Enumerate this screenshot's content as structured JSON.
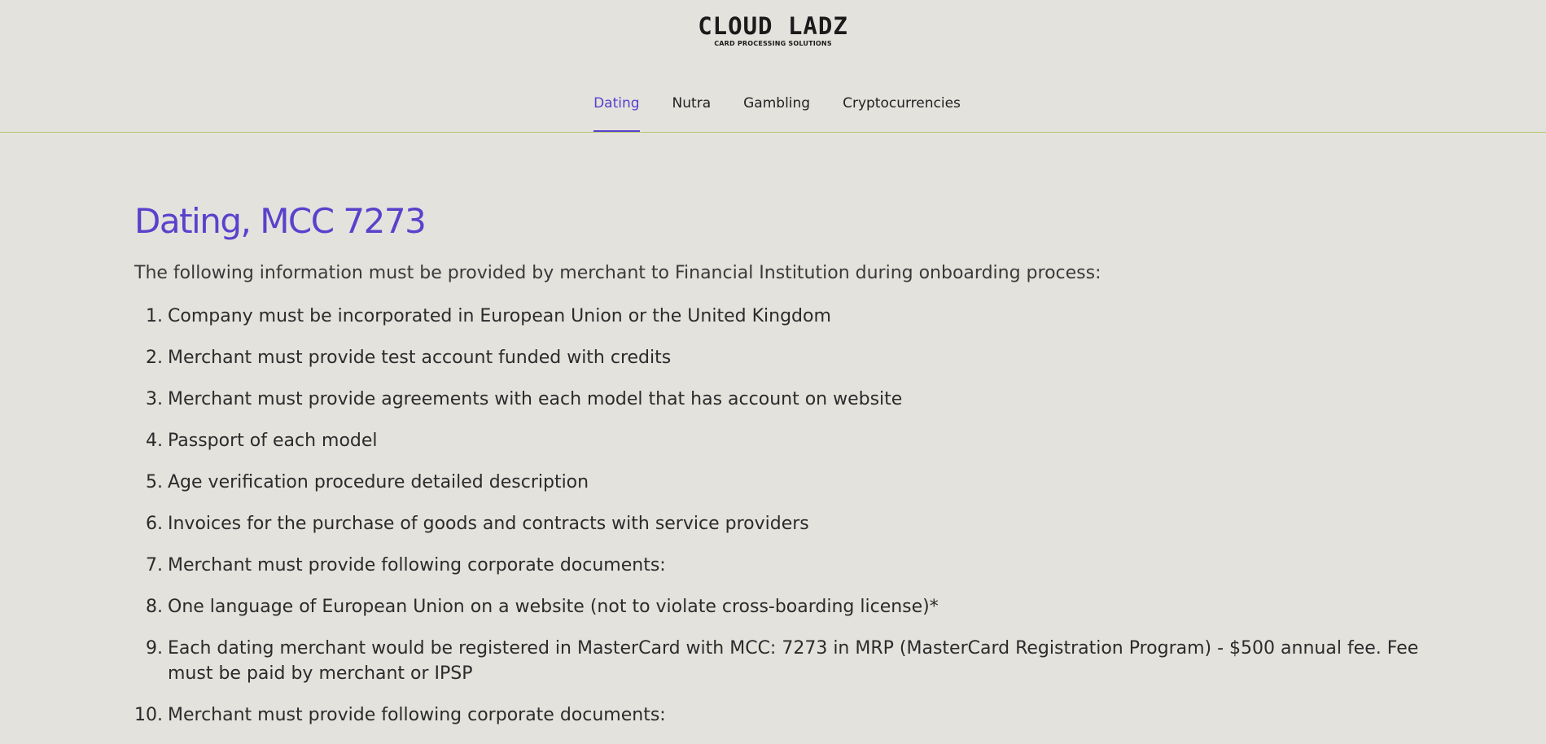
{
  "logo": {
    "title": "CLOUD LADZ",
    "subtitle": "CARD PROCESSING SOLUTIONS"
  },
  "nav": {
    "tabs": [
      {
        "label": "Dating",
        "active": true
      },
      {
        "label": "Nutra",
        "active": false
      },
      {
        "label": "Gambling",
        "active": false
      },
      {
        "label": "Cryptocurrencies",
        "active": false
      }
    ]
  },
  "main": {
    "title": "Dating, MCC 7273",
    "intro": "The following information must be provided by merchant to Financial Institution during onboarding process:",
    "requirements": [
      {
        "num": "1.",
        "text": "Company must be incorporated in European Union or the United Kingdom"
      },
      {
        "num": "2.",
        "text": "Merchant must provide test account funded with credits"
      },
      {
        "num": "3.",
        "text": "Merchant must provide agreements with each model that has account on website"
      },
      {
        "num": "4.",
        "text": "Passport of each model"
      },
      {
        "num": "5.",
        "text": "Age verification procedure detailed description"
      },
      {
        "num": "6.",
        "text": "Invoices for the purchase of goods and contracts with service providers"
      },
      {
        "num": "7.",
        "text": "Merchant must provide following corporate documents:"
      },
      {
        "num": "8.",
        "text": "One language of European Union on a website (not to violate cross-boarding license)*"
      },
      {
        "num": "9.",
        "text": "Each dating merchant would be registered in MasterCard with MCC: 7273 in MRP (MasterCard Registration Program) - $500 annual fee. Fee must be paid by merchant or IPSP"
      },
      {
        "num": "10.",
        "text": "Merchant must provide following corporate documents:"
      }
    ]
  },
  "colors": {
    "background": "#e3e2dd",
    "accent": "#5a41cc",
    "divider": "#b4c96a",
    "text": "#2b2b2b"
  }
}
